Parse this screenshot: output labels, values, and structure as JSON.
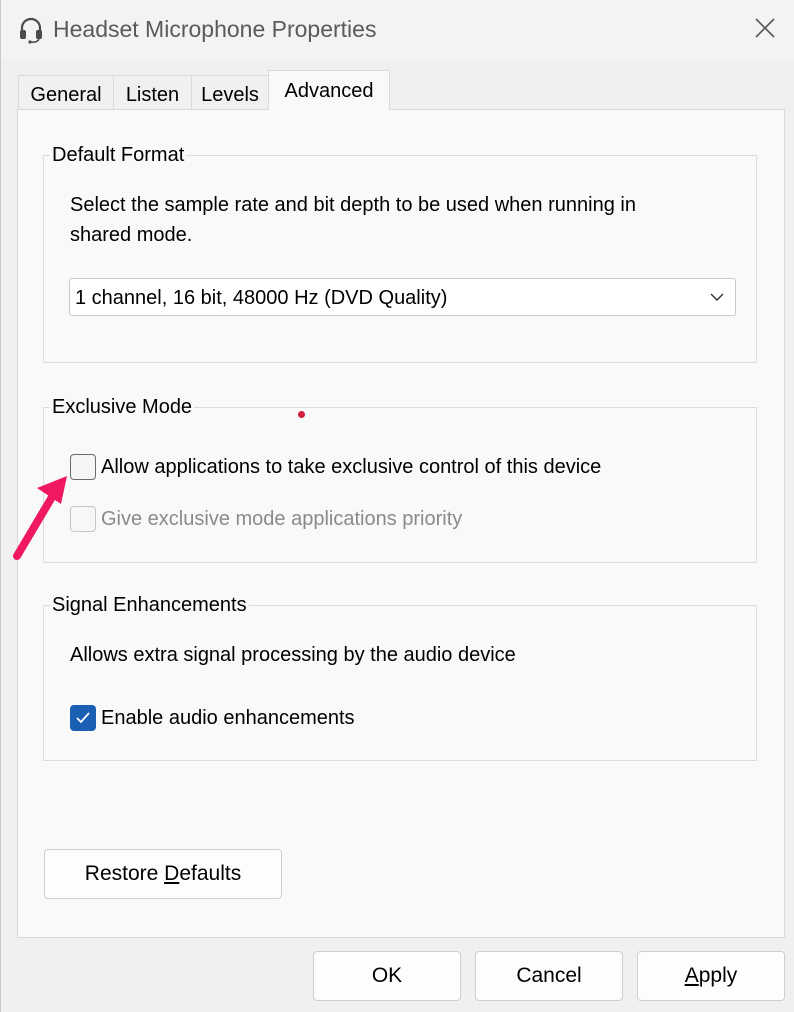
{
  "window": {
    "title": "Headset Microphone Properties"
  },
  "tabs": [
    {
      "label": "General",
      "active": false
    },
    {
      "label": "Listen",
      "active": false
    },
    {
      "label": "Levels",
      "active": false
    },
    {
      "label": "Advanced",
      "active": true
    }
  ],
  "default_format": {
    "group_label": "Default Format",
    "description_line1": "Select the sample rate and bit depth to be used when running in",
    "description_line2": "shared mode.",
    "selected_format": "1 channel, 16 bit, 48000 Hz (DVD Quality)"
  },
  "exclusive_mode": {
    "group_label": "Exclusive Mode",
    "allow_exclusive": {
      "label": "Allow applications to take exclusive control of this device",
      "checked": false
    },
    "priority": {
      "label": "Give exclusive mode applications priority",
      "checked": false,
      "enabled": false
    }
  },
  "signal_enhancements": {
    "group_label": "Signal Enhancements",
    "description": "Allows extra signal processing by the audio device",
    "enable_enhancements": {
      "label": "Enable audio enhancements",
      "checked": true
    }
  },
  "buttons": {
    "restore_prefix": "Restore ",
    "restore_underlined": "D",
    "restore_suffix": "efaults",
    "ok": "OK",
    "cancel": "Cancel",
    "apply_underlined": "A",
    "apply_suffix": "pply"
  },
  "colors": {
    "accent": "#1a5fb4",
    "annotation_arrow": "#f0195f",
    "annotation_dot": "#d21f3c"
  },
  "icons": {
    "title_icon": "headset-icon",
    "close_icon": "close-icon",
    "dropdown_icon": "chevron-down-icon",
    "check_icon": "checkmark-icon"
  }
}
